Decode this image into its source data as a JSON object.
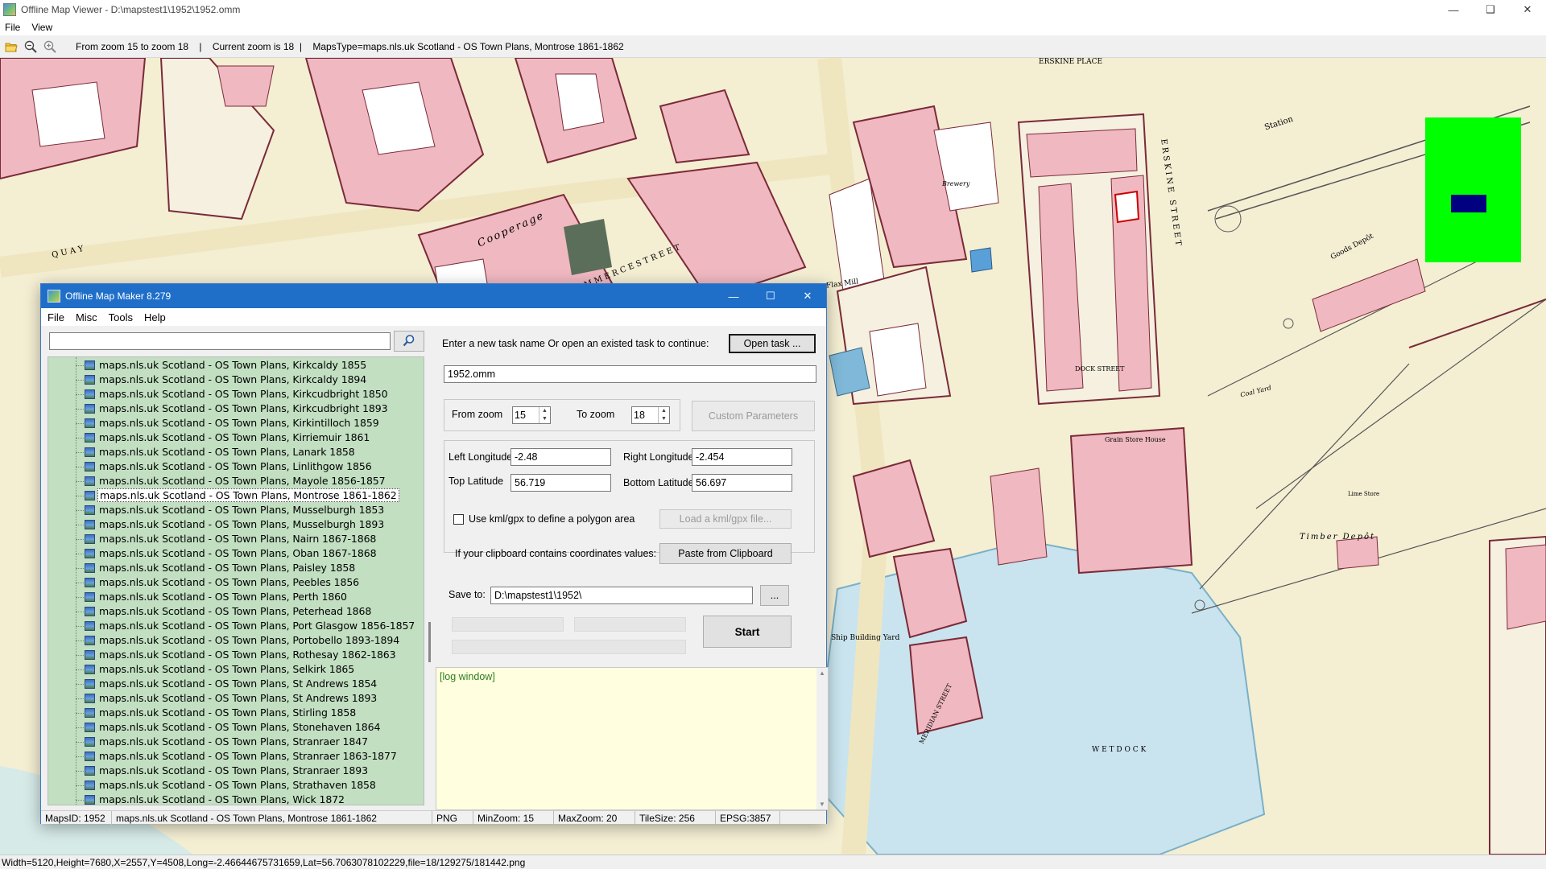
{
  "viewer": {
    "title": "Offline Map Viewer - D:\\mapstest1\\1952\\1952.omm",
    "menu": [
      "File",
      "View"
    ],
    "toolbar_info": "From zoom 15 to zoom 18    |    Current zoom is 18  |    MapsType=maps.nls.uk Scotland - OS Town Plans, Montrose 1861-1862",
    "status": "Width=5120,Height=7680,X=2557,Y=4508,Long=-2.46644675731659,Lat=56.7063078102229,file=18/129275/181442.png",
    "icons": [
      "open-folder-icon",
      "zoom-out-icon",
      "zoom-in-icon"
    ],
    "overview_color": "#00ff00",
    "overview_rect_color": "#000080"
  },
  "map_labels": {
    "erskine_place": "ERSKINE PLACE",
    "erskine_street": "ERSKINE STREET",
    "station": "Station",
    "goods_depot": "Goods Depôt",
    "dock_street": "DOCK STREET",
    "grain_store": "Grain Store House",
    "timber_depot": "Timber Depôt",
    "ship_yard": "Ship Building Yard",
    "wet_dock": "W E T     D O C K",
    "flax_mill": "Flax Mill",
    "cooperage": "Cooperage",
    "quay": "Q U A Y",
    "coal_yard": "Coal Yard",
    "brewery": "Brewery",
    "lime_store": "Lime Store",
    "commerce_street": "C O M M E R C E     S T R E E T",
    "meridian_street": "MERIDIAN STREET"
  },
  "dialog": {
    "title": "Offline Map Maker 8.279",
    "menu": [
      "File",
      "Misc",
      "Tools",
      "Help"
    ],
    "search_placeholder": "",
    "search_icon": "magnifier-icon",
    "task_prompt": "Enter a new task name Or open an existed task to continue:",
    "open_task_label": "Open task ...",
    "task_name": "1952.omm",
    "from_zoom_label": "From zoom",
    "from_zoom_value": "15",
    "to_zoom_label": "To zoom",
    "to_zoom_value": "18",
    "custom_params_label": "Custom Parameters",
    "left_lon_label": "Left Longitude",
    "left_lon_value": "-2.48",
    "right_lon_label": "Right Longitude",
    "right_lon_value": "-2.454",
    "top_lat_label": "Top Latitude",
    "top_lat_value": "56.719",
    "bottom_lat_label": "Bottom Latitude",
    "bottom_lat_value": "56.697",
    "kml_check_label": "Use kml/gpx to define a polygon area",
    "load_kml_label": "Load a kml/gpx file...",
    "clipboard_text": "If your clipboard contains coordinates values:",
    "paste_label": "Paste from Clipboard",
    "save_to_label": "Save to:",
    "save_to_value": "D:\\mapstest1\\1952\\",
    "browse_label": "...",
    "start_label": "Start",
    "log_text": "[log window]",
    "tree_items": [
      "maps.nls.uk Scotland - OS Town Plans, Kirkcaldy 1855",
      "maps.nls.uk Scotland - OS Town Plans, Kirkcaldy 1894",
      "maps.nls.uk Scotland - OS Town Plans, Kirkcudbright 1850",
      "maps.nls.uk Scotland - OS Town Plans, Kirkcudbright 1893",
      "maps.nls.uk Scotland - OS Town Plans, Kirkintilloch 1859",
      "maps.nls.uk Scotland - OS Town Plans, Kirriemuir 1861",
      "maps.nls.uk Scotland - OS Town Plans, Lanark 1858",
      "maps.nls.uk Scotland - OS Town Plans, Linlithgow 1856",
      "maps.nls.uk Scotland - OS Town Plans, Mayole 1856-1857",
      "maps.nls.uk Scotland - OS Town Plans, Montrose 1861-1862",
      "maps.nls.uk Scotland - OS Town Plans, Musselburgh 1853",
      "maps.nls.uk Scotland - OS Town Plans, Musselburgh 1893",
      "maps.nls.uk Scotland - OS Town Plans, Nairn 1867-1868",
      "maps.nls.uk Scotland - OS Town Plans, Oban 1867-1868",
      "maps.nls.uk Scotland - OS Town Plans, Paisley 1858",
      "maps.nls.uk Scotland - OS Town Plans, Peebles 1856",
      "maps.nls.uk Scotland - OS Town Plans, Perth 1860",
      "maps.nls.uk Scotland - OS Town Plans, Peterhead 1868",
      "maps.nls.uk Scotland - OS Town Plans, Port Glasgow 1856-1857",
      "maps.nls.uk Scotland - OS Town Plans, Portobello 1893-1894",
      "maps.nls.uk Scotland - OS Town Plans, Rothesay 1862-1863",
      "maps.nls.uk Scotland - OS Town Plans, Selkirk 1865",
      "maps.nls.uk Scotland - OS Town Plans, St Andrews 1854",
      "maps.nls.uk Scotland - OS Town Plans, St Andrews 1893",
      "maps.nls.uk Scotland - OS Town Plans, Stirling 1858",
      "maps.nls.uk Scotland - OS Town Plans, Stonehaven 1864",
      "maps.nls.uk Scotland - OS Town Plans, Stranraer 1847",
      "maps.nls.uk Scotland - OS Town Plans, Stranraer 1863-1877",
      "maps.nls.uk Scotland - OS Town Plans, Stranraer 1893",
      "maps.nls.uk Scotland - OS Town Plans, Strathaven 1858",
      "maps.nls.uk Scotland - OS Town Plans, Wick 1872"
    ],
    "selected_index": 9,
    "status": {
      "maps_id": "MapsID: 1952",
      "map_name": "maps.nls.uk Scotland - OS Town Plans, Montrose 1861-1862",
      "format": "PNG",
      "min_zoom": "MinZoom: 15",
      "max_zoom": "MaxZoom: 20",
      "tile_size": "TileSize: 256",
      "epsg": "EPSG:3857"
    },
    "accent_color": "#1f6fc9",
    "tree_bg_color": "#c2dfc2",
    "log_bg_color": "#ffffe0"
  }
}
